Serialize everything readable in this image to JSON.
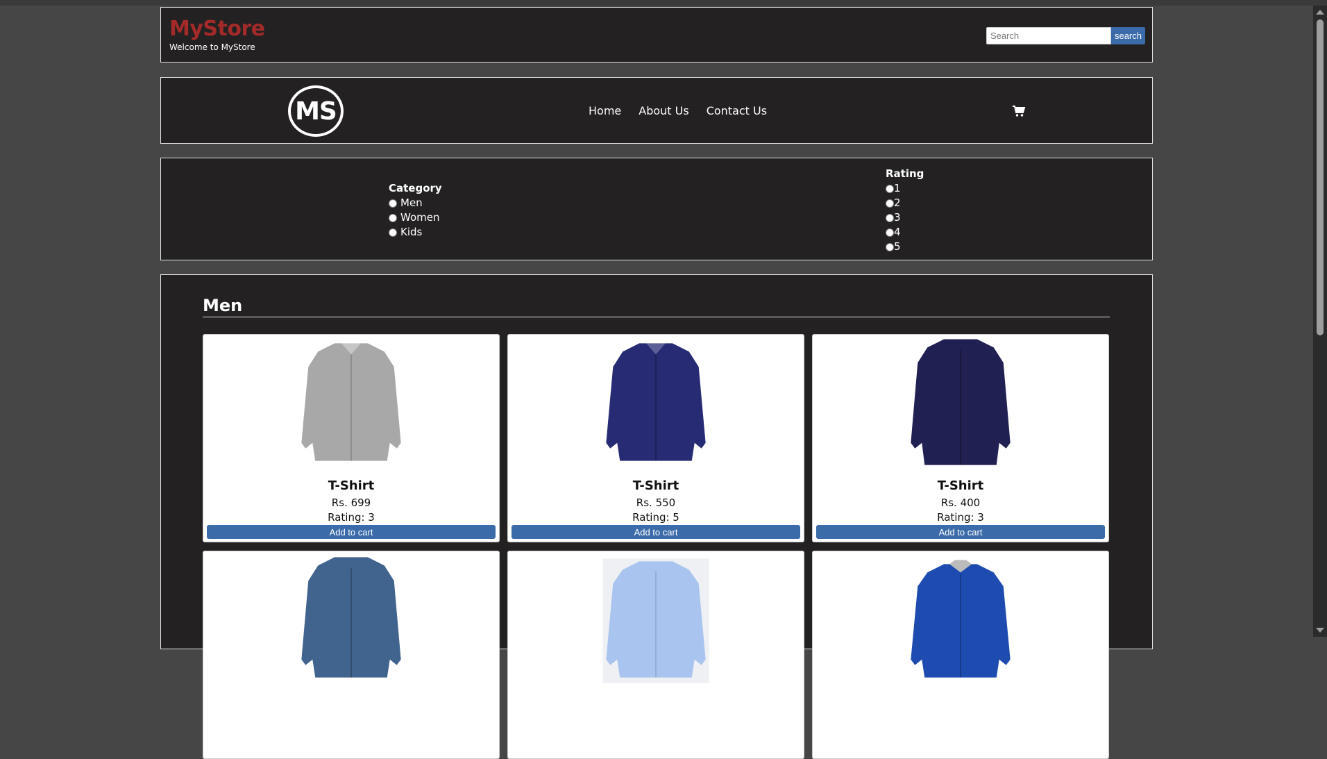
{
  "header": {
    "brand_title": "MyStore",
    "brand_subtitle": "Welcome to MyStore",
    "search_placeholder": "Search",
    "search_button": "search"
  },
  "nav": {
    "logo_text": "MS",
    "links": [
      "Home",
      "About Us",
      "Contact Us"
    ],
    "cart_icon": "cart-icon"
  },
  "filters": {
    "category_title": "Category",
    "categories": [
      "Men",
      "Women",
      "Kids"
    ],
    "rating_title": "Rating",
    "ratings": [
      "1",
      "2",
      "3",
      "4",
      "5"
    ]
  },
  "section": {
    "title": "Men",
    "products": [
      {
        "name": "T-Shirt",
        "price": "Rs. 699",
        "rating": "Rating: 3",
        "button": "Add to cart",
        "color": "#a8a8a8"
      },
      {
        "name": "T-Shirt",
        "price": "Rs. 550",
        "rating": "Rating: 5",
        "button": "Add to cart",
        "color": "#272b74"
      },
      {
        "name": "T-Shirt",
        "price": "Rs. 400",
        "rating": "Rating: 3",
        "button": "Add to cart",
        "color": "#202052"
      },
      {
        "name": "",
        "price": "",
        "rating": "",
        "button": "",
        "color": "#41648f"
      },
      {
        "name": "",
        "price": "",
        "rating": "",
        "button": "",
        "color": "#a9c4ee"
      },
      {
        "name": "",
        "price": "",
        "rating": "",
        "button": "",
        "color": "#1d4bb0"
      }
    ]
  },
  "colors": {
    "brand": "#a42a2a",
    "accent": "#3b6ba9",
    "panel": "#232122",
    "page": "#474646"
  }
}
